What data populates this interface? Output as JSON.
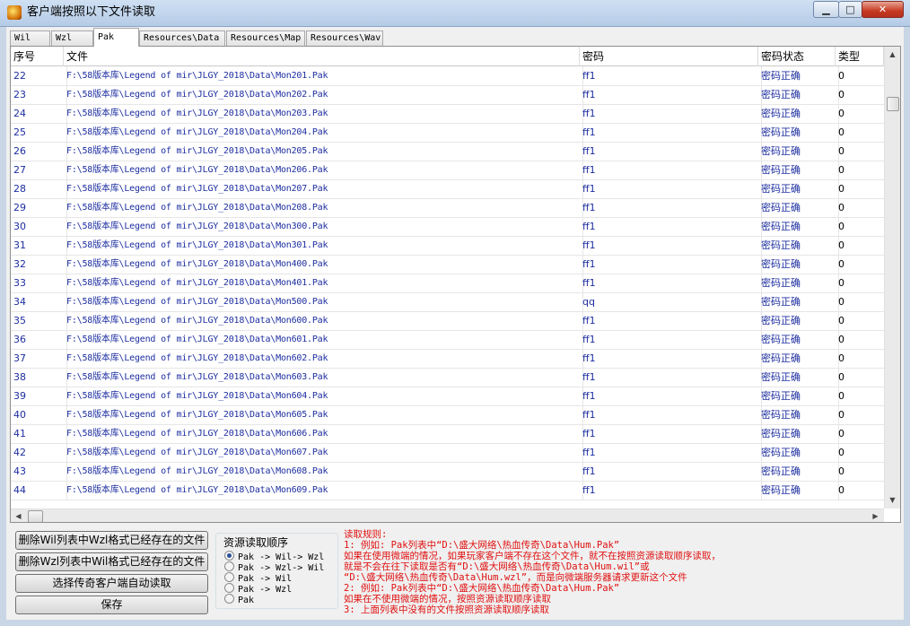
{
  "window": {
    "title": "客户端按照以下文件读取",
    "minimize_glyph": "▁",
    "maximize_glyph": "□",
    "close_glyph": "✕"
  },
  "tabs": [
    {
      "label": "Wil",
      "active": false
    },
    {
      "label": "Wzl",
      "active": false
    },
    {
      "label": "Pak",
      "active": true
    },
    {
      "label": "Resources\\Data",
      "active": false
    },
    {
      "label": "Resources\\Map",
      "active": false
    },
    {
      "label": "Resources\\Wav",
      "active": false
    }
  ],
  "table": {
    "columns": [
      "序号",
      "文件",
      "密码",
      "密码状态",
      "类型"
    ],
    "rows": [
      [
        "22",
        "F:\\58版本库\\Legend of mir\\JLGY_2018\\Data\\Mon201.Pak",
        "ff1",
        "密码正确",
        "0"
      ],
      [
        "23",
        "F:\\58版本库\\Legend of mir\\JLGY_2018\\Data\\Mon202.Pak",
        "ff1",
        "密码正确",
        "0"
      ],
      [
        "24",
        "F:\\58版本库\\Legend of mir\\JLGY_2018\\Data\\Mon203.Pak",
        "ff1",
        "密码正确",
        "0"
      ],
      [
        "25",
        "F:\\58版本库\\Legend of mir\\JLGY_2018\\Data\\Mon204.Pak",
        "ff1",
        "密码正确",
        "0"
      ],
      [
        "26",
        "F:\\58版本库\\Legend of mir\\JLGY_2018\\Data\\Mon205.Pak",
        "ff1",
        "密码正确",
        "0"
      ],
      [
        "27",
        "F:\\58版本库\\Legend of mir\\JLGY_2018\\Data\\Mon206.Pak",
        "ff1",
        "密码正确",
        "0"
      ],
      [
        "28",
        "F:\\58版本库\\Legend of mir\\JLGY_2018\\Data\\Mon207.Pak",
        "ff1",
        "密码正确",
        "0"
      ],
      [
        "29",
        "F:\\58版本库\\Legend of mir\\JLGY_2018\\Data\\Mon208.Pak",
        "ff1",
        "密码正确",
        "0"
      ],
      [
        "30",
        "F:\\58版本库\\Legend of mir\\JLGY_2018\\Data\\Mon300.Pak",
        "ff1",
        "密码正确",
        "0"
      ],
      [
        "31",
        "F:\\58版本库\\Legend of mir\\JLGY_2018\\Data\\Mon301.Pak",
        "ff1",
        "密码正确",
        "0"
      ],
      [
        "32",
        "F:\\58版本库\\Legend of mir\\JLGY_2018\\Data\\Mon400.Pak",
        "ff1",
        "密码正确",
        "0"
      ],
      [
        "33",
        "F:\\58版本库\\Legend of mir\\JLGY_2018\\Data\\Mon401.Pak",
        "ff1",
        "密码正确",
        "0"
      ],
      [
        "34",
        "F:\\58版本库\\Legend of mir\\JLGY_2018\\Data\\Mon500.Pak",
        "qq",
        "密码正确",
        "0"
      ],
      [
        "35",
        "F:\\58版本库\\Legend of mir\\JLGY_2018\\Data\\Mon600.Pak",
        "ff1",
        "密码正确",
        "0"
      ],
      [
        "36",
        "F:\\58版本库\\Legend of mir\\JLGY_2018\\Data\\Mon601.Pak",
        "ff1",
        "密码正确",
        "0"
      ],
      [
        "37",
        "F:\\58版本库\\Legend of mir\\JLGY_2018\\Data\\Mon602.Pak",
        "ff1",
        "密码正确",
        "0"
      ],
      [
        "38",
        "F:\\58版本库\\Legend of mir\\JLGY_2018\\Data\\Mon603.Pak",
        "ff1",
        "密码正确",
        "0"
      ],
      [
        "39",
        "F:\\58版本库\\Legend of mir\\JLGY_2018\\Data\\Mon604.Pak",
        "ff1",
        "密码正确",
        "0"
      ],
      [
        "40",
        "F:\\58版本库\\Legend of mir\\JLGY_2018\\Data\\Mon605.Pak",
        "ff1",
        "密码正确",
        "0"
      ],
      [
        "41",
        "F:\\58版本库\\Legend of mir\\JLGY_2018\\Data\\Mon606.Pak",
        "ff1",
        "密码正确",
        "0"
      ],
      [
        "42",
        "F:\\58版本库\\Legend of mir\\JLGY_2018\\Data\\Mon607.Pak",
        "ff1",
        "密码正确",
        "0"
      ],
      [
        "43",
        "F:\\58版本库\\Legend of mir\\JLGY_2018\\Data\\Mon608.Pak",
        "ff1",
        "密码正确",
        "0"
      ],
      [
        "44",
        "F:\\58版本库\\Legend of mir\\JLGY_2018\\Data\\Mon609.Pak",
        "ff1",
        "密码正确",
        "0"
      ]
    ]
  },
  "buttons": {
    "delete_wzl": "删除Wil列表中Wzl格式已经存在的文件",
    "delete_wil": "删除Wzl列表中Wil格式已经存在的文件",
    "select_client": "选择传奇客户端自动读取",
    "save": "保存"
  },
  "resource_order": {
    "title": "资源读取顺序",
    "options": [
      {
        "label": "Pak -> Wil-> Wzl",
        "checked": true
      },
      {
        "label": "Pak -> Wzl-> Wil",
        "checked": false
      },
      {
        "label": "Pak -> Wil",
        "checked": false
      },
      {
        "label": "Pak -> Wzl",
        "checked": false
      },
      {
        "label": "Pak",
        "checked": false
      }
    ]
  },
  "rules": [
    "读取规则:",
    "1: 例如: Pak列表中“D:\\盛大网络\\热血传奇\\Data\\Hum.Pak”",
    "    如果在使用微端的情况，如果玩家客户端不存在这个文件，就不在按照资源读取顺序读取，",
    "    就是不会在往下读取是否有“D:\\盛大网络\\热血传奇\\Data\\Hum.wil”或",
    "  “D:\\盛大网络\\热血传奇\\Data\\Hum.wzl”，而是向微端服务器请求更新这个文件",
    "2: 例如: Pak列表中“D:\\盛大网络\\热血传奇\\Data\\Hum.Pak”",
    "    如果在不使用微端的情况，按照资源读取顺序读取",
    "3: 上面列表中没有的文件按照资源读取顺序读取"
  ],
  "scroll": {
    "up": "▲",
    "down": "▼",
    "left": "◀",
    "right": "▶"
  }
}
